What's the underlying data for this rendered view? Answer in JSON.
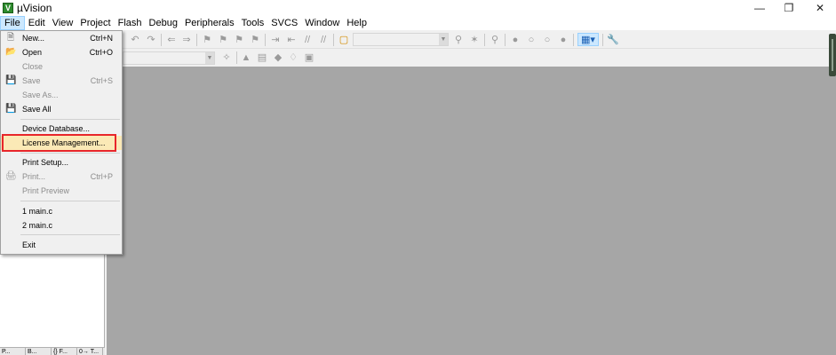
{
  "window": {
    "title": "µVision"
  },
  "menubar": [
    "File",
    "Edit",
    "View",
    "Project",
    "Flash",
    "Debug",
    "Peripherals",
    "Tools",
    "SVCS",
    "Window",
    "Help"
  ],
  "file_menu": {
    "new": {
      "label": "New...",
      "shortcut": "Ctrl+N"
    },
    "open": {
      "label": "Open",
      "shortcut": "Ctrl+O"
    },
    "close": {
      "label": "Close"
    },
    "save": {
      "label": "Save",
      "shortcut": "Ctrl+S"
    },
    "save_as": {
      "label": "Save As..."
    },
    "save_all": {
      "label": "Save All"
    },
    "device_database": {
      "label": "Device Database..."
    },
    "license_management": {
      "label": "License Management..."
    },
    "print_setup": {
      "label": "Print Setup..."
    },
    "print": {
      "label": "Print...",
      "shortcut": "Ctrl+P"
    },
    "print_preview": {
      "label": "Print Preview"
    },
    "recent_1": {
      "label": "1 main.c"
    },
    "recent_2": {
      "label": "2 main.c"
    },
    "exit": {
      "label": "Exit"
    }
  },
  "left_tabs": [
    "P...",
    "B...",
    "{} F...",
    "0→ T..."
  ],
  "colors": {
    "editor_bg": "#a6a6a6",
    "highlight_border": "#e8262a",
    "menu_active": "#cce8ff"
  },
  "icons": [
    "app-icon",
    "minimize-icon",
    "restore-icon",
    "close-icon",
    "new-file-icon",
    "open-folder-icon",
    "save-icon",
    "save-all-icon",
    "print-icon"
  ]
}
